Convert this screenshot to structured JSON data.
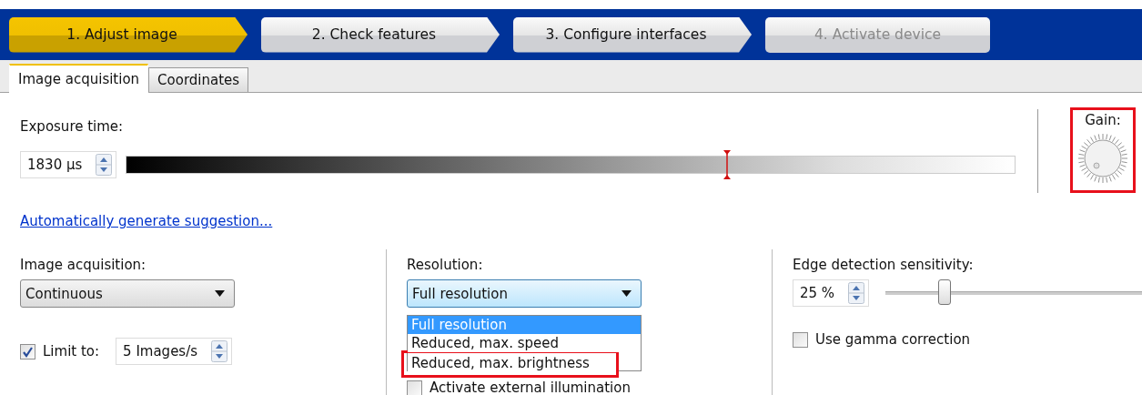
{
  "wizard": {
    "steps": [
      {
        "label": "1. Adjust image",
        "selected": true,
        "disabled": false
      },
      {
        "label": "2. Check features",
        "selected": false,
        "disabled": false
      },
      {
        "label": "3. Configure interfaces",
        "selected": false,
        "disabled": false
      },
      {
        "label": "4. Activate device",
        "selected": false,
        "disabled": true
      }
    ]
  },
  "tabs": [
    {
      "label": "Image acquisition",
      "selected": true
    },
    {
      "label": "Coordinates",
      "selected": false
    }
  ],
  "exposure": {
    "label": "Exposure time:",
    "value": "1830 µs",
    "level": 0.676
  },
  "gain": {
    "label": "Gain:",
    "highlighted": true
  },
  "suggestion_link": "Automatically generate suggestion...",
  "acquisition": {
    "label": "Image acquisition:",
    "value": "Continuous",
    "limit": {
      "label": "Limit to:",
      "checked": true,
      "value": "5 Images/s"
    }
  },
  "resolution": {
    "label": "Resolution:",
    "value": "Full resolution",
    "options": [
      {
        "label": "Full resolution",
        "selected": true,
        "highlighted": false
      },
      {
        "label": "Reduced, max. speed",
        "selected": false,
        "highlighted": false
      },
      {
        "label": "Reduced, max. brightness",
        "selected": false,
        "highlighted": true
      }
    ],
    "illumination": {
      "label": "Activate external illumination",
      "checked": false
    }
  },
  "edge": {
    "label": "Edge detection sensitivity:",
    "value": "25 %",
    "level": 0.23,
    "gamma": {
      "label": "Use gamma correction",
      "checked": false
    }
  }
}
